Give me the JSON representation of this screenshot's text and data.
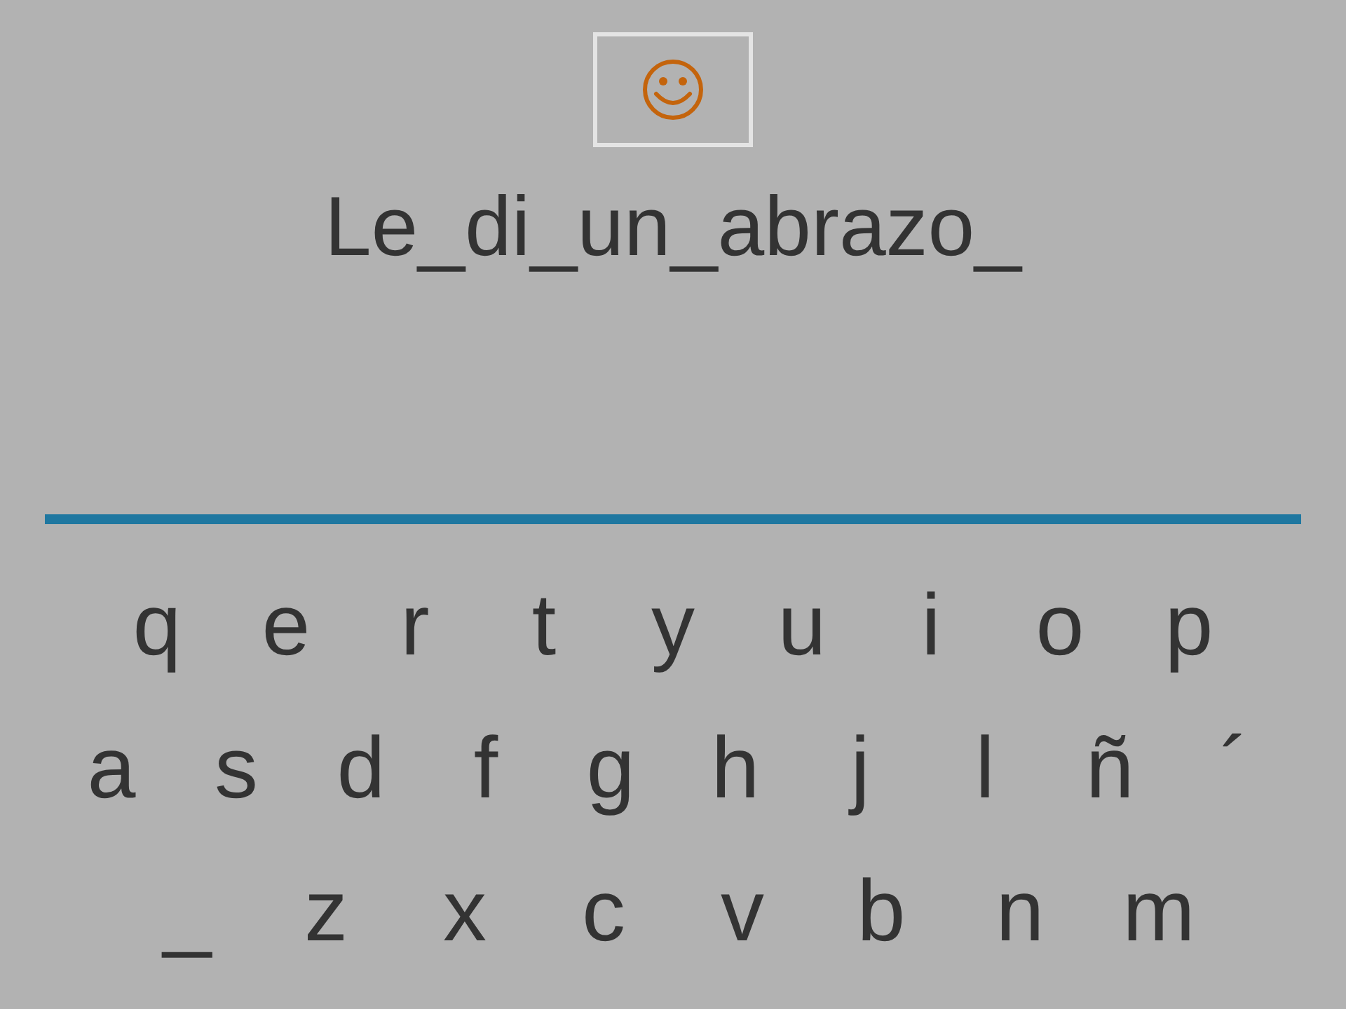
{
  "sentence": "Le_di_un_abrazo_",
  "keyboard": {
    "rows": [
      [
        "q",
        "e",
        "r",
        "t",
        "y",
        "u",
        "i",
        "o",
        "p"
      ],
      [
        "a",
        "s",
        "d",
        "f",
        "g",
        "h",
        "j",
        "l",
        "ñ",
        "´"
      ],
      [
        "_",
        "z",
        "x",
        "c",
        "v",
        "b",
        "n",
        "m"
      ]
    ]
  }
}
